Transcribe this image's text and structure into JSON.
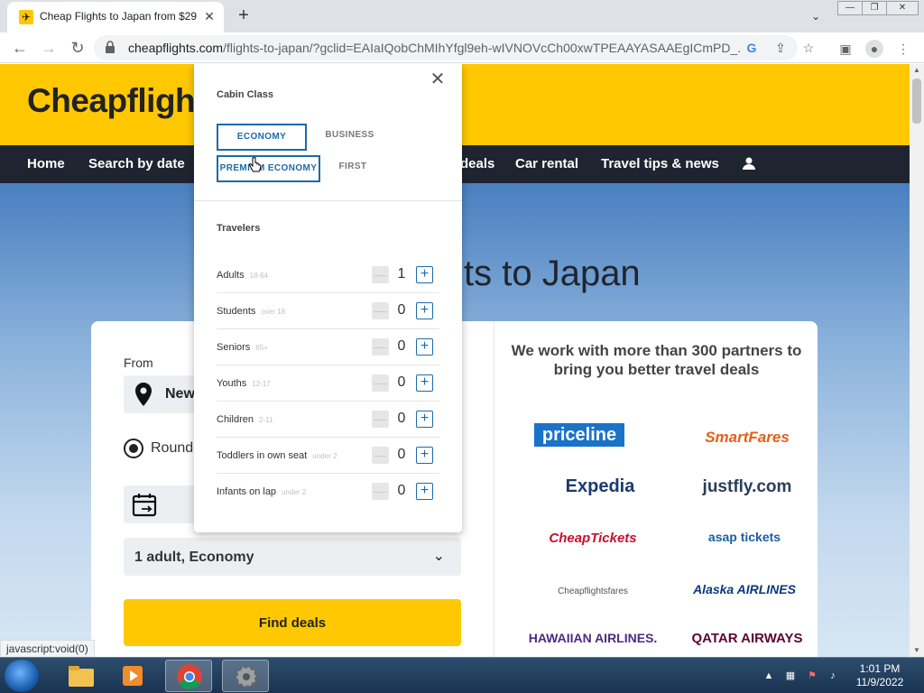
{
  "browser": {
    "tab_title": "Cheap Flights to Japan from $29",
    "tab_close": "✕",
    "new_tab": "+",
    "url_host": "cheapflights.com",
    "url_path": "/flights-to-japan/?gclid=EAIaIQobChMIhYfgl9eh-wIVNOVcCh00xwTPEAAYASAAEgICmPD_...",
    "window_buttons": [
      "—",
      "❐",
      "✕"
    ]
  },
  "site": {
    "logo": "Cheapflights",
    "nav": [
      "Home",
      "Search by date",
      "deals",
      "Car rental",
      "Travel tips & news"
    ],
    "hero_title": "Cheap Flights to Japan"
  },
  "search": {
    "from_label": "From",
    "from_value": "New",
    "trip_type": "Round-",
    "travelers_value": "1 adult, Economy",
    "find_deals": "Find deals"
  },
  "partners": {
    "heading": "We work with more than 300 partners to bring you better travel deals",
    "logos": [
      "priceline",
      "SmartFares",
      "Expedia",
      "justfly.com",
      "CheapTickets",
      "asap tickets",
      "Cheapflightsfares",
      "Alaska AIRLINES",
      "HAWAIIAN AIRLINES.",
      "QATAR AIRWAYS"
    ]
  },
  "popup": {
    "cabin_heading": "Cabin Class",
    "cabin_options": [
      {
        "label": "ECONOMY",
        "selected": true
      },
      {
        "label": "BUSINESS",
        "selected": false
      },
      {
        "label": "PREMIUM ECONOMY",
        "selected": false
      },
      {
        "label": "FIRST",
        "selected": false
      }
    ],
    "travelers_heading": "Travelers",
    "travelers": [
      {
        "label": "Adults",
        "age": "18-64",
        "count": "1"
      },
      {
        "label": "Students",
        "age": "over 18",
        "count": "0"
      },
      {
        "label": "Seniors",
        "age": "65+",
        "count": "0"
      },
      {
        "label": "Youths",
        "age": "12-17",
        "count": "0"
      },
      {
        "label": "Children",
        "age": "2-11",
        "count": "0"
      },
      {
        "label": "Toddlers in own seat",
        "age": "under 2",
        "count": "0"
      },
      {
        "label": "Infants on lap",
        "age": "under 2",
        "count": "0"
      }
    ],
    "minus_symbol": "—",
    "plus_symbol": "+"
  },
  "status_text": "javascript:void(0)",
  "taskbar": {
    "time": "1:01 PM",
    "date": "11/9/2022"
  },
  "colors": {
    "brand_yellow": "#ffc800",
    "nav_dark": "#1f2530",
    "accent_blue": "#1e6aa8"
  }
}
